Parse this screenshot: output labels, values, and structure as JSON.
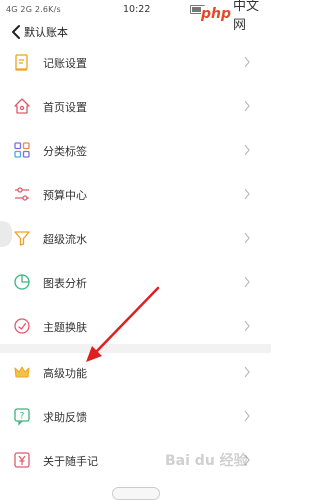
{
  "status": {
    "left": "4G  2G  2.6K/s",
    "time": "10:22"
  },
  "watermark": {
    "php": "php",
    "cn": "中文网"
  },
  "header": {
    "title": "默认账本"
  },
  "menu": [
    {
      "label": "记账设置",
      "icon": "pencil-note-icon"
    },
    {
      "label": "首页设置",
      "icon": "home-icon"
    },
    {
      "label": "分类标签",
      "icon": "category-grid-icon"
    },
    {
      "label": "预算中心",
      "icon": "sliders-icon"
    },
    {
      "label": "超级流水",
      "icon": "funnel-icon"
    },
    {
      "label": "图表分析",
      "icon": "pie-chart-icon"
    },
    {
      "label": "主题换肤",
      "icon": "theme-icon"
    },
    {
      "label": "高级功能",
      "icon": "crown-icon"
    },
    {
      "label": "求助反馈",
      "icon": "help-chat-icon"
    },
    {
      "label": "关于随手记",
      "icon": "about-yen-icon"
    }
  ],
  "colors": {
    "accent": "#f0a020",
    "arrow": "#e02020"
  },
  "watermark_bottom": "Bai du 经验"
}
